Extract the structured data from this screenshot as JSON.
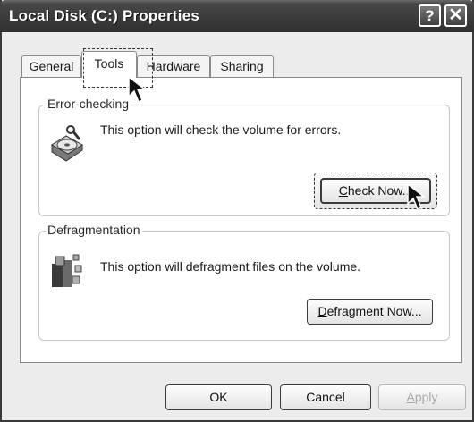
{
  "window": {
    "title": "Local Disk (C:) Properties",
    "help_glyph": "?",
    "close_glyph": "✕"
  },
  "tabs": [
    {
      "label": "General",
      "selected": false
    },
    {
      "label": "Tools",
      "selected": true
    },
    {
      "label": "Hardware",
      "selected": false
    },
    {
      "label": "Sharing",
      "selected": false
    }
  ],
  "error_checking": {
    "label": "Error-checking",
    "icon": "disk-check-icon",
    "text": "This option will check the volume for errors.",
    "button": {
      "mnemonic": "C",
      "rest": "heck Now..."
    }
  },
  "defragmentation": {
    "label": "Defragmentation",
    "icon": "defragment-icon",
    "text": "This option will defragment files on the volume.",
    "button": {
      "mnemonic": "D",
      "rest": "efragment Now..."
    }
  },
  "footer": {
    "ok": "OK",
    "cancel": "Cancel",
    "apply": {
      "mnemonic": "A",
      "rest": "pply",
      "disabled": true
    }
  },
  "colors": {
    "titlebar": "#3b3b3b",
    "window_bg": "#ececec",
    "panel_bg": "#ffffff",
    "disabled_text": "#a9a9a9"
  },
  "icons": [
    "help-icon",
    "close-icon",
    "mouse-pointer-icon"
  ]
}
